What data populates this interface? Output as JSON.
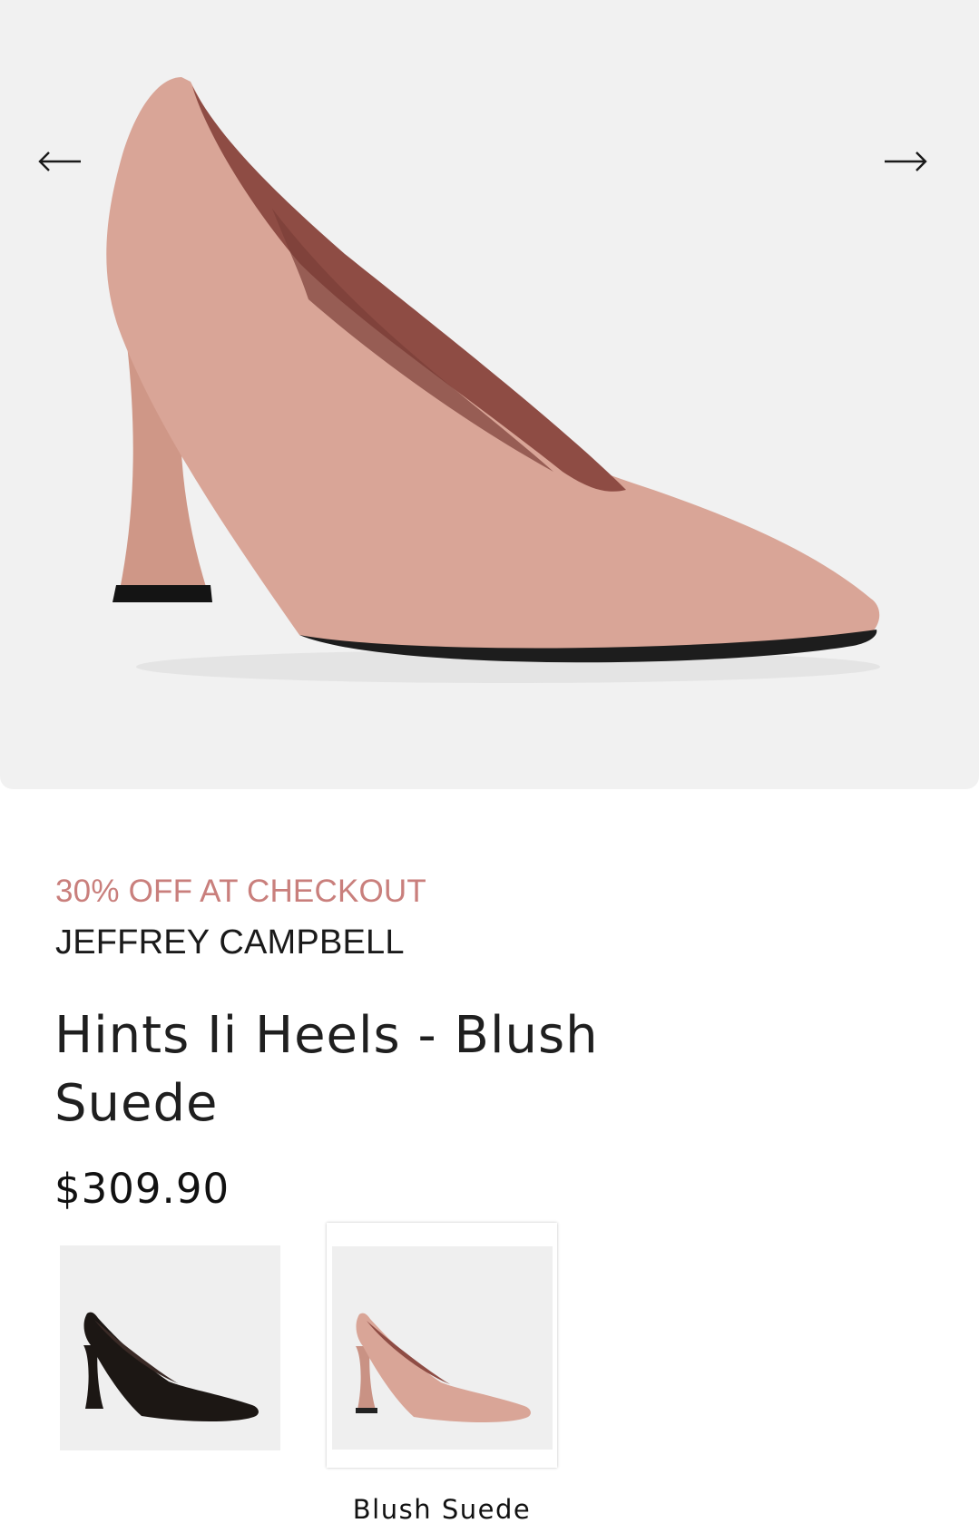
{
  "gallery": {
    "prev_icon": "arrow-left-icon",
    "next_icon": "arrow-right-icon",
    "background": "#f1f1f1"
  },
  "product": {
    "promo": "30% OFF AT CHECKOUT",
    "brand": "JEFFREY CAMPBELL",
    "title": "Hints Ii Heels - Blush Suede",
    "price": "$309.90"
  },
  "variants": [
    {
      "color": "#1c1714",
      "selected": false
    },
    {
      "label": "Blush Suede",
      "color": "#d9a597",
      "selected": true
    }
  ],
  "colors": {
    "promo": "#c97f7c",
    "shoe": "#d9a597",
    "lining": "#8e4c44"
  }
}
